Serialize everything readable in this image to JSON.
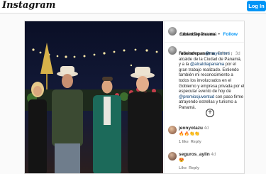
{
  "app": {
    "logo": "Instagram",
    "login_label": "Log In"
  },
  "post": {
    "author": "rubendepanama",
    "separator": "•",
    "follow_label": "Follow",
    "location": "Ciudad De Panamá",
    "caption_author": "rubendepanama",
    "edited_label": "Edited •",
    "caption_time": "3d",
    "caption_parts": [
      "Felicitamos a ",
      "@mayerrmm",
      " , alcalde de la Ciudad de Panamá, y a la ",
      "@alcaldiapanama",
      " por el gran trabajo realizado. Extiendo también mi reconocimiento a todos los involucrados en el Gobierno y empresa privada por el especular evento de hoy de ",
      "@premiosjuventud",
      " con paso firme atrayendo estrellas y turismo a Panamá."
    ],
    "more_icon": "plus-circle-icon"
  },
  "comments": [
    {
      "user": "jennyotazu",
      "time": "4d",
      "text": "🔥🔥👏👏",
      "likes": "1 like",
      "reply": "Reply"
    },
    {
      "user": "seguros_aylin",
      "time": "4d",
      "text": "😍",
      "likes": "Like",
      "reply": "Reply"
    }
  ],
  "colors": {
    "accent": "#0095f6",
    "mention": "#00376b",
    "border": "#dbdbdb"
  }
}
